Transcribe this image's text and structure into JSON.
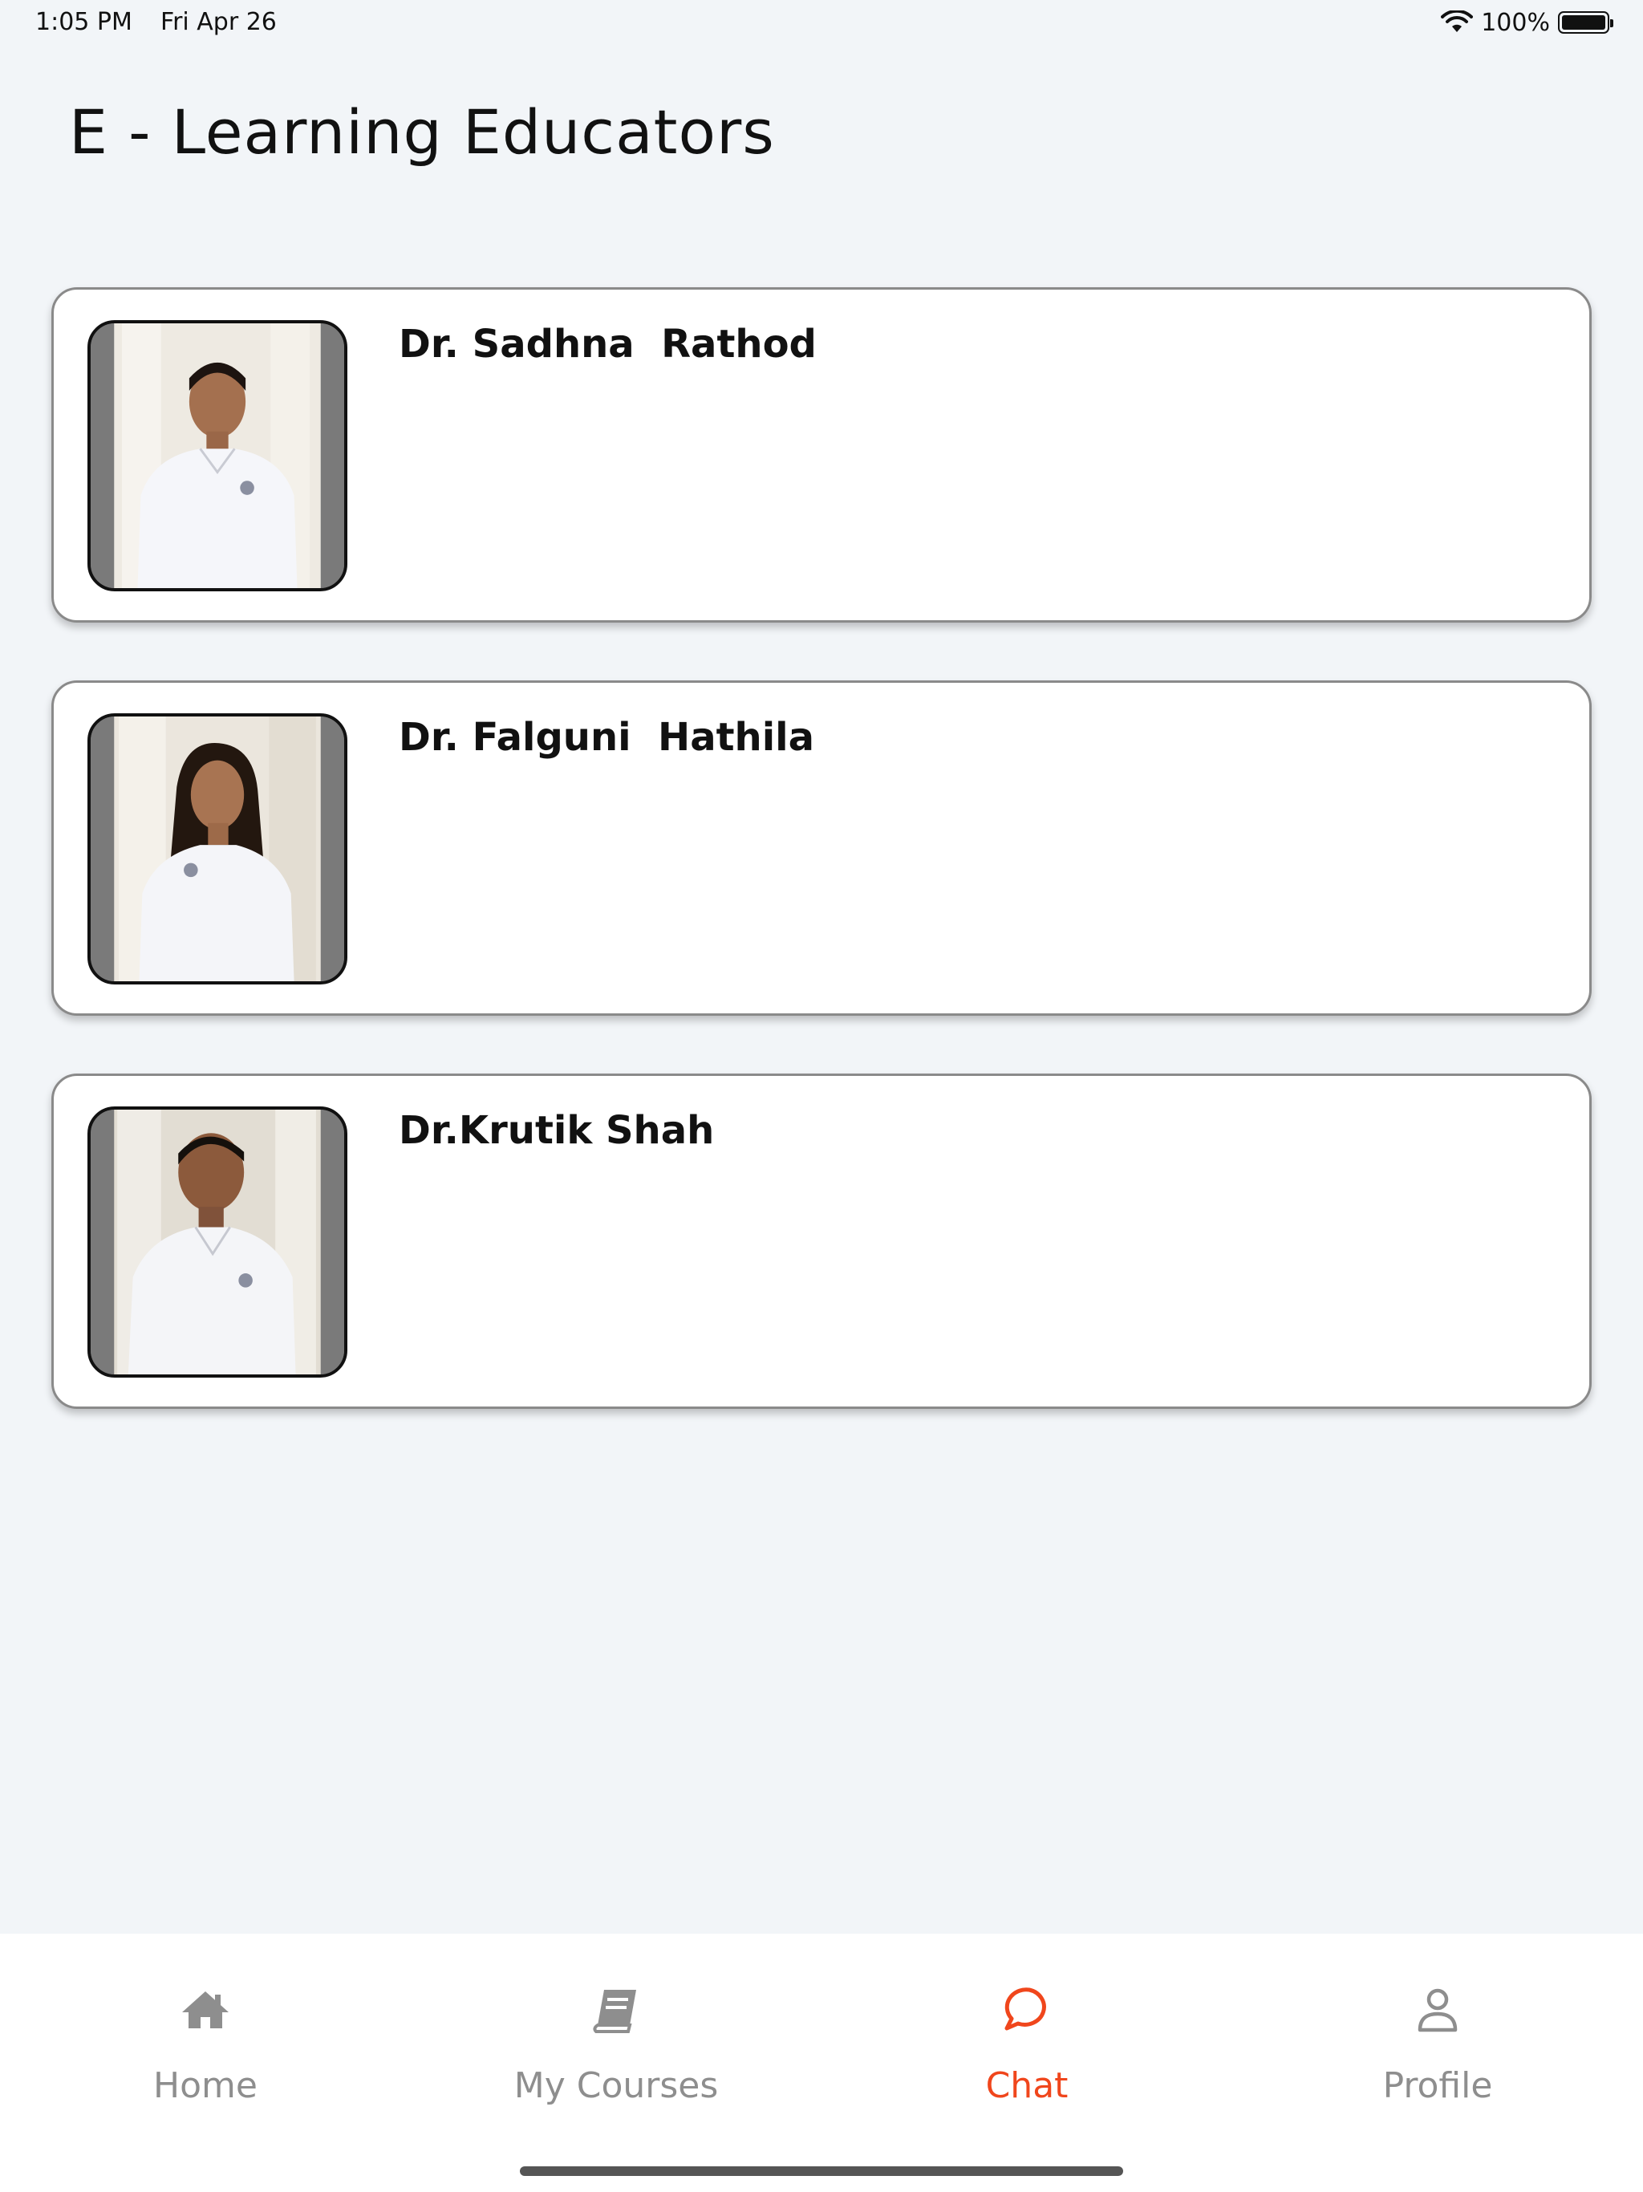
{
  "status_bar": {
    "time": "1:05 PM",
    "date": "Fri Apr 26",
    "battery": "100%"
  },
  "page": {
    "title": "E - Learning Educators"
  },
  "educators": [
    {
      "name": "Dr. Sadhna  Rathod"
    },
    {
      "name": "Dr. Falguni  Hathila"
    },
    {
      "name": "Dr.Krutik Shah"
    }
  ],
  "tab_bar": {
    "active_color": "#f0461c",
    "items": [
      {
        "label": "Home",
        "icon": "home-icon"
      },
      {
        "label": "My Courses",
        "icon": "book-icon"
      },
      {
        "label": "Chat",
        "icon": "chat-bubble-icon",
        "active": true
      },
      {
        "label": "Profile",
        "icon": "person-icon"
      }
    ]
  }
}
